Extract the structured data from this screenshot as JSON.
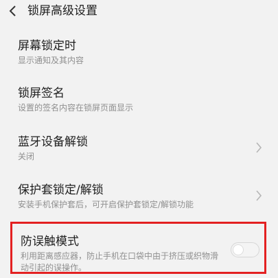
{
  "header": {
    "title": "锁屏高级设置",
    "back_icon": "back-chevron-icon"
  },
  "items": [
    {
      "title": "屏幕锁定时",
      "subtitle": "显示通知及其内容",
      "has_arrow": false
    },
    {
      "title": "锁屏签名",
      "subtitle": "设置的签名内容在锁屏页面显示",
      "has_arrow": false
    },
    {
      "title": "蓝牙设备解锁",
      "subtitle": "关闭",
      "has_arrow": true
    },
    {
      "title": "保护套锁定/解锁",
      "subtitle": "安装手机保护套后，可开启保护套锁定/解锁功能",
      "has_arrow": true
    }
  ],
  "anti_mistouch": {
    "title": "防误触模式",
    "subtitle": "利用距离感应器，防止手机在口袋中由于挤压或织物滑动引起的误操作。",
    "toggle_on": false
  },
  "colors": {
    "highlight_border": "#e32021",
    "title_text": "#1e1e1e",
    "subtitle_text": "#8f8f8f",
    "background": "#f2f2f2"
  }
}
